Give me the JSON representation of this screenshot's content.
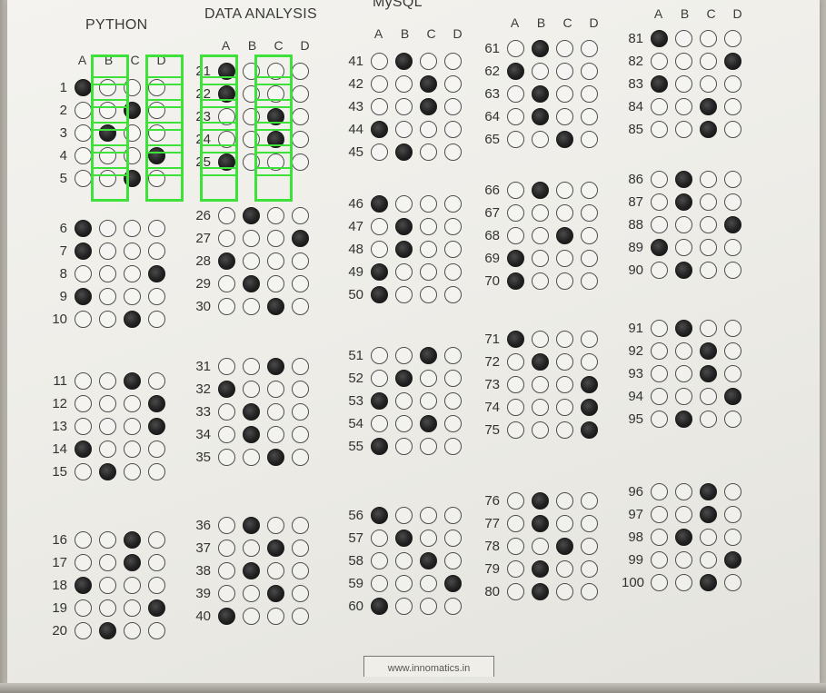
{
  "letters": [
    "A",
    "B",
    "C",
    "D"
  ],
  "sections": [
    {
      "title": "PYTHON",
      "start": 1,
      "end": 20
    },
    {
      "title": "DATA ANALYSIS",
      "start": 21,
      "end": 40
    },
    {
      "title": "MySQL",
      "start": 41,
      "end": 60
    },
    {
      "title": "",
      "start": 61,
      "end": 80
    },
    {
      "title": "",
      "start": 81,
      "end": 100
    }
  ],
  "answers": {
    "1": "A",
    "2": "C",
    "3": "B",
    "4": "D",
    "5": "C",
    "6": "A",
    "7": "A",
    "8": "D",
    "9": "A",
    "10": "C",
    "11": "C",
    "12": "D",
    "13": "D",
    "14": "A",
    "15": "B",
    "16": "C",
    "17": "C",
    "18": "A",
    "19": "D",
    "20": "B",
    "21": "A",
    "22": "A",
    "23": "C",
    "24": "C",
    "25": "A",
    "26": "B",
    "27": "D",
    "28": "A",
    "29": "B",
    "30": "C",
    "31": "C",
    "32": "A",
    "33": "B",
    "34": "B",
    "35": "C",
    "36": "B",
    "37": "C",
    "38": "B",
    "39": "C",
    "40": "A",
    "41": "B",
    "42": "C",
    "43": "C",
    "44": "A",
    "45": "B",
    "46": "A",
    "47": "B",
    "48": "B",
    "49": "A",
    "50": "A",
    "51": "C",
    "52": "B",
    "53": "A",
    "54": "C",
    "55": "A",
    "56": "A",
    "57": "B",
    "58": "C",
    "59": "D",
    "60": "A",
    "61": "B",
    "62": "A",
    "63": "B",
    "64": "B",
    "65": "C",
    "66": "B",
    "67": "",
    "68": "C",
    "69": "A",
    "70": "A",
    "71": "A",
    "72": "B",
    "73": "D",
    "74": "D",
    "75": "D",
    "76": "B",
    "77": "B",
    "78": "C",
    "79": "B",
    "80": "B",
    "81": "A",
    "82": "D",
    "83": "A",
    "84": "C",
    "85": "C",
    "86": "B",
    "87": "B",
    "88": "D",
    "89": "A",
    "90": "B",
    "91": "B",
    "92": "C",
    "93": "C",
    "94": "D",
    "95": "B",
    "96": "C",
    "97": "C",
    "98": "B",
    "99": "D",
    "100": "C"
  },
  "footer": "www.innomatics.in",
  "colors": {
    "detection": "#3ee03a",
    "ink": "#1a1a1a",
    "paper": "#f1f0ec"
  }
}
